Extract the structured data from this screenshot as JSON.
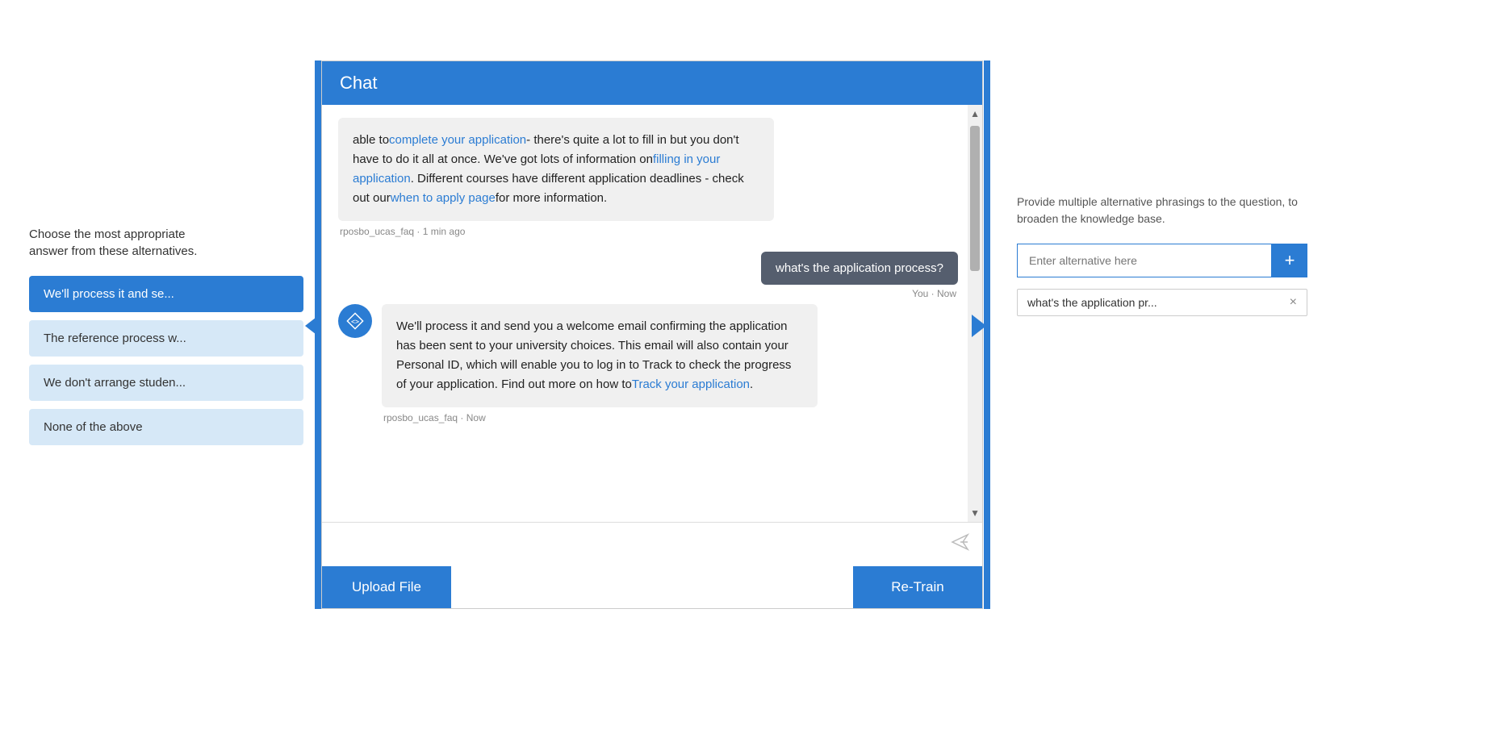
{
  "left_panel": {
    "title": "Choose the most appropriate\nanswer from these alternatives.",
    "answers": [
      {
        "id": "ans1",
        "label": "We'll process it and se...",
        "active": true
      },
      {
        "id": "ans2",
        "label": "The reference process w...",
        "active": false
      },
      {
        "id": "ans3",
        "label": "We don't arrange studen...",
        "active": false
      },
      {
        "id": "ans4",
        "label": "None of the above",
        "active": false
      }
    ]
  },
  "chat": {
    "header_label": "Chat",
    "messages": [
      {
        "type": "bot_partial",
        "text_prefix": "able to",
        "link1_text": "complete your application",
        "link1_url": "#",
        "text_mid": "- there's quite a lot to fill in but you don't have to do it all at once. We've got lots of information on",
        "link2_text": "filling in your application",
        "link2_url": "#",
        "text_suffix": ". Different courses have different application deadlines - check out our",
        "link3_text": "when to apply page",
        "link3_url": "#",
        "text_end": "for more information.",
        "sender": "rposbo_ucas_faq",
        "time": "1 min ago"
      },
      {
        "type": "user",
        "text": "what's the application process?",
        "sender": "You",
        "time": "Now"
      },
      {
        "type": "bot",
        "text_prefix": "We'll process it and send you a welcome email confirming the application has been sent to your university choices. This email will also contain your Personal ID, which will enable you to log in to Track to check the progress of your application. Find out more on how to",
        "link_text": "Track your application",
        "link_url": "#",
        "text_suffix": ".",
        "sender": "rposbo_ucas_faq",
        "time": "Now"
      }
    ],
    "input_placeholder": "",
    "upload_btn": "Upload File",
    "retrain_btn": "Re-Train"
  },
  "right_panel": {
    "description": "Provide multiple alternative phrasings to the question, to broaden the knowledge base.",
    "input_placeholder": "Enter alternative here",
    "add_btn_label": "+",
    "alternatives": [
      {
        "id": "alt1",
        "text": "what's the application pr..."
      }
    ]
  }
}
